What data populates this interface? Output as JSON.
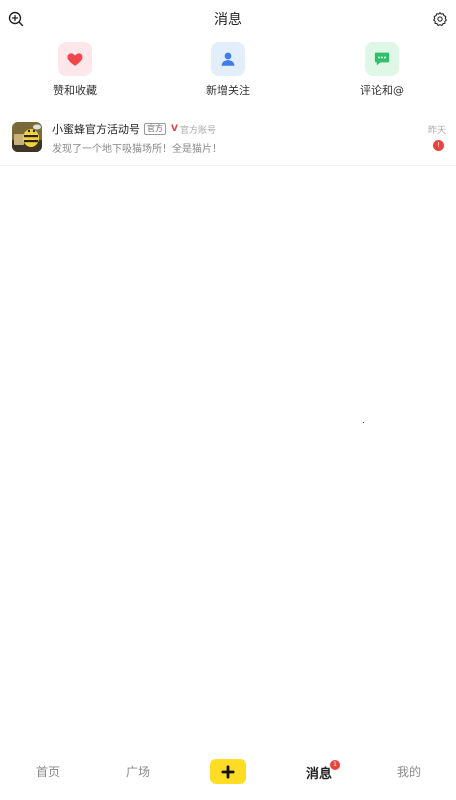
{
  "header": {
    "title": "消息",
    "left_icon": "add-search-icon",
    "right_icon": "gear-icon"
  },
  "categories": [
    {
      "label": "赞和收藏",
      "icon": "heart-icon",
      "color": "#f0464c"
    },
    {
      "label": "新增关注",
      "icon": "person-icon",
      "color": "#3d7de6"
    },
    {
      "label": "评论和@",
      "icon": "chat-bubble-icon",
      "color": "#2fc06a"
    }
  ],
  "messages": [
    {
      "sender": "小蜜蜂官方活动号",
      "tag": "官方",
      "badge": "V",
      "account_type": "官方账号",
      "preview": "发现了一个地下吸猫场所！全是猫片！",
      "time": "昨天",
      "unread": "!"
    }
  ],
  "bottom_nav": {
    "home": "首页",
    "plaza": "广场",
    "add": "+",
    "messages": "消息",
    "messages_badge": "1",
    "mine": "我的"
  },
  "colors": {
    "accent_yellow": "#ffdd24",
    "badge_red": "#e9453e"
  }
}
